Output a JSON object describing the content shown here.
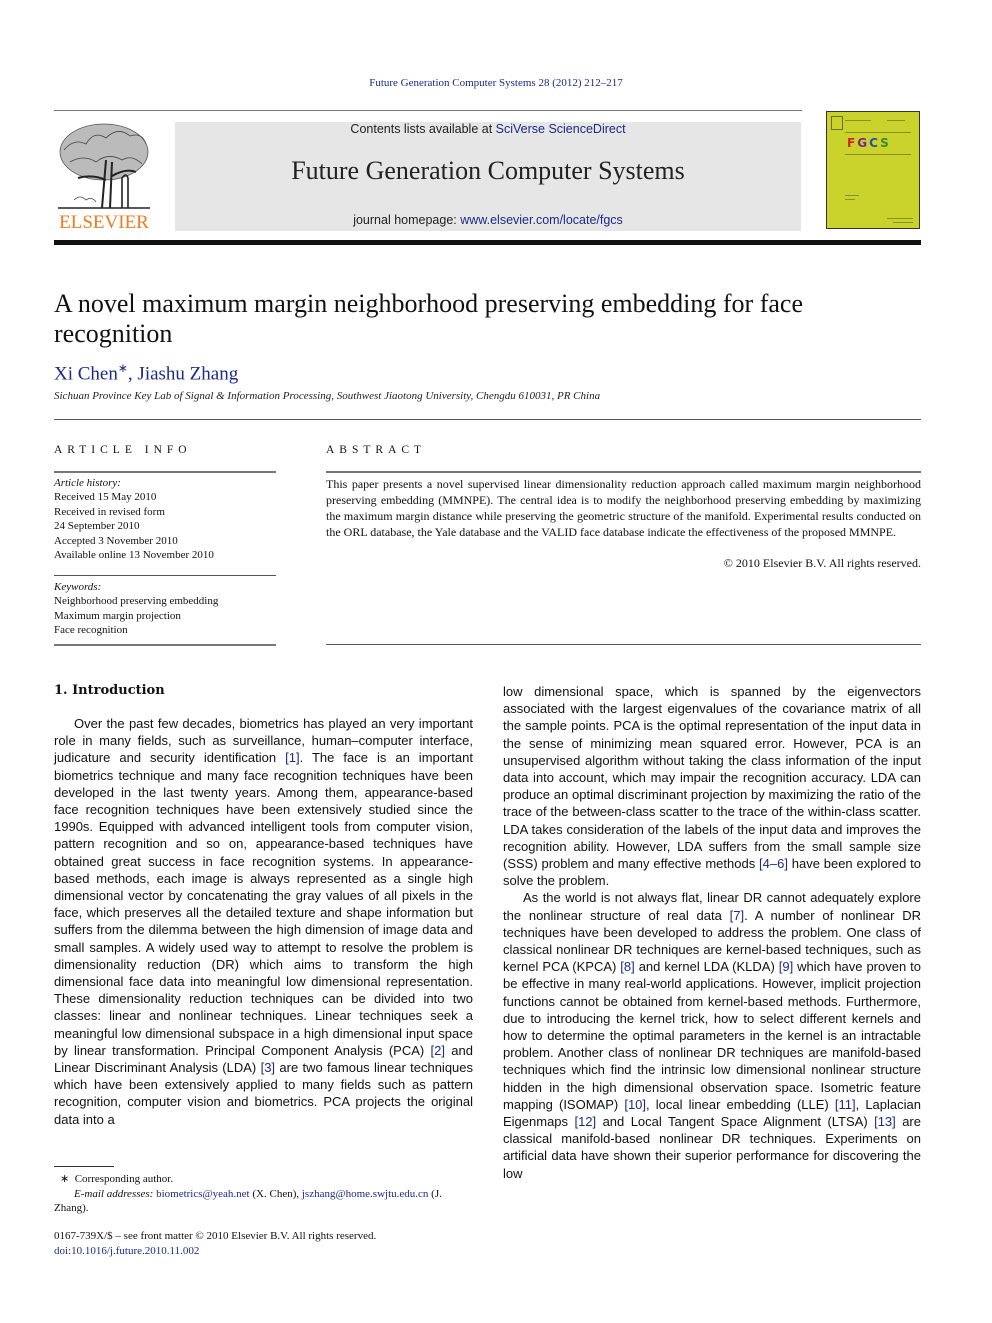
{
  "header": {
    "journal_reference": "Future Generation Computer Systems 28 (2012) 212–217",
    "publisher_wordmark": "ELSEVIER",
    "contents_prefix": "Contents lists available at ",
    "contents_link": "SciVerse ScienceDirect",
    "journal_title": "Future Generation Computer Systems",
    "homepage_prefix": "journal homepage: ",
    "homepage_link": "www.elsevier.com/locate/fgcs",
    "cover_letters": [
      "F",
      "G",
      "C",
      "S"
    ],
    "cover_letter_colors": [
      "#d0242b",
      "#7a2a8c",
      "#2b4fa6",
      "#3a8a3a"
    ],
    "brand_color": "#f07a1c",
    "link_color": "#1b2a86",
    "cover_color": "#c9d32b"
  },
  "article": {
    "title": "A novel maximum margin neighborhood preserving embedding for face recognition",
    "authors": [
      {
        "name": "Xi Chen",
        "mark": "∗"
      },
      {
        "name": "Jiashu Zhang",
        "mark": ""
      }
    ],
    "author_separator": ", ",
    "affiliation": "Sichuan Province Key Lab of Signal & Information Processing, Southwest Jiaotong University, Chengdu 610031, PR China"
  },
  "article_info": {
    "heading": "ARTICLE INFO",
    "history_label": "Article history:",
    "history": [
      "Received 15 May 2010",
      "Received in revised form",
      "24 September 2010",
      "Accepted 3 November 2010",
      "Available online 13 November 2010"
    ],
    "keywords_label": "Keywords:",
    "keywords": [
      "Neighborhood preserving embedding",
      "Maximum margin projection",
      "Face recognition"
    ]
  },
  "abstract": {
    "heading": "ABSTRACT",
    "text": "This paper presents a novel supervised linear dimensionality reduction approach called maximum margin neighborhood preserving embedding (MMNPE). The central idea is to modify the neighborhood preserving embedding by maximizing the maximum margin distance while preserving the geometric structure of the manifold. Experimental results conducted on the ORL database, the Yale database and the VALID face database indicate the effectiveness of the proposed MMNPE.",
    "copyright": "© 2010 Elsevier B.V. All rights reserved."
  },
  "body": {
    "section_heading": "1.  Introduction",
    "left_column": [
      {
        "text": "Over the past few decades, biometrics has played an very important role in many fields, such as surveillance, human–computer interface, judicature and security identification ",
        "ref": "[1]",
        "after": ". The face is an important biometrics technique and many face recognition techniques have been developed in the last twenty years. Among them, appearance-based face recognition techniques have been extensively studied since the 1990s. Equipped with advanced intelligent tools from computer vision, pattern recognition and so on, appearance-based techniques have obtained great success in face recognition systems. In appearance-based methods, each image is always represented as a single high dimensional vector by concatenating the gray values of all pixels in the face, which preserves all the detailed texture and shape information but suffers from the dilemma between the high dimension of image data and small samples. A widely used way to attempt to resolve the problem is dimensionality reduction (DR) which aims to transform the high dimensional face data into meaningful low dimensional representation. These dimensionality reduction techniques can be divided into two classes: linear and nonlinear techniques. Linear techniques seek a meaningful low dimensional subspace in a high dimensional input space by linear transformation. Principal Component Analysis (PCA) ",
        "ref2": "[2]",
        "after2": " and Linear Discriminant Analysis (LDA) ",
        "ref3": "[3]",
        "after3": " are two famous linear techniques which have been extensively applied to many fields such as pattern recognition, computer vision and biometrics. PCA projects the original data into a"
      }
    ],
    "right_column": {
      "p1_a": "low dimensional space, which is spanned by the eigenvectors associated with the largest eigenvalues of the covariance matrix of all the sample points. PCA is the optimal representation of the input data in the sense of minimizing mean squared error. However, PCA is an unsupervised algorithm without taking the class information of the input data into account, which may impair the recognition accuracy. LDA can produce an optimal discriminant projection by maximizing the ratio of the trace of the between-class scatter to the trace of the within-class scatter. LDA takes consideration of the labels of the input data and improves the recognition ability. However, LDA suffers from the small sample size (SSS) problem and many effective methods ",
      "p1_ref": "[4–6]",
      "p1_b": " have been explored to solve the problem.",
      "p2_a": "As the world is not always flat, linear DR cannot adequately explore the nonlinear structure of real data ",
      "p2_ref1": "[7]",
      "p2_b": ". A number of nonlinear DR techniques have been developed to address the problem. One class of classical nonlinear DR techniques are kernel-based techniques, such as kernel PCA (KPCA) ",
      "p2_ref2": "[8]",
      "p2_c": " and kernel LDA (KLDA) ",
      "p2_ref3": "[9]",
      "p2_d": " which have proven to be effective in many real-world applications. However, implicit projection functions cannot be obtained from kernel-based methods. Furthermore, due to introducing the kernel trick, how to select different kernels and how to determine the optimal parameters in the kernel is an intractable problem. Another class of nonlinear DR techniques are manifold-based techniques which find the intrinsic low dimensional nonlinear structure hidden in the high dimensional observation space. Isometric feature mapping (ISOMAP) ",
      "p2_ref4": "[10]",
      "p2_e": ", local linear embedding (LLE) ",
      "p2_ref5": "[11]",
      "p2_f": ", Laplacian Eigenmaps ",
      "p2_ref6": "[12]",
      "p2_g": " and Local Tangent Space Alignment (LTSA) ",
      "p2_ref7": "[13]",
      "p2_h": " are classical manifold-based nonlinear DR techniques. Experiments on artificial data have shown their superior performance for discovering the low"
    }
  },
  "footnotes": {
    "mark": "∗",
    "corresponding": "Corresponding author.",
    "email_label": "E-mail addresses:",
    "email_1": "biometrics@yeah.net",
    "email_1_owner": " (X. Chen), ",
    "email_2": "jszhang@home.swjtu.edu.cn",
    "email_2_owner": " (J. Zhang).",
    "front_matter": "0167-739X/$ – see front matter © 2010 Elsevier B.V. All rights reserved.",
    "doi": "doi:10.1016/j.future.2010.11.002"
  }
}
